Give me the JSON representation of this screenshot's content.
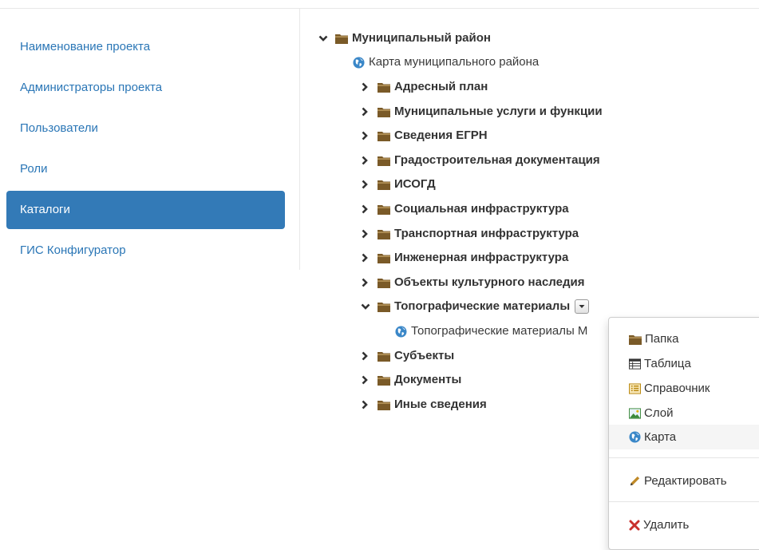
{
  "colors": {
    "link": "#2a76b6",
    "active_bg": "#337ab7",
    "folder_icon": "#7a5a28",
    "globe_icon": "#3a87c8",
    "delete_icon": "#c9302c"
  },
  "sidebar": {
    "items": [
      {
        "label": "Наименование проекта",
        "active": false
      },
      {
        "label": "Администраторы проекта",
        "active": false
      },
      {
        "label": "Пользователи",
        "active": false
      },
      {
        "label": "Роли",
        "active": false
      },
      {
        "label": "Каталоги",
        "active": true
      },
      {
        "label": "ГИС Конфигуратор",
        "active": false
      }
    ]
  },
  "tree": {
    "root": {
      "label": "Муниципальный район",
      "icon": "folder-icon",
      "expanded": true
    },
    "root_map": {
      "label": "Карта муниципального района",
      "icon": "globe-icon"
    },
    "folders": [
      {
        "label": "Адресный план",
        "expanded": false
      },
      {
        "label": "Муниципальные услуги и функции",
        "expanded": false
      },
      {
        "label": "Сведения ЕГРН",
        "expanded": false
      },
      {
        "label": "Градостроительная документация",
        "expanded": false
      },
      {
        "label": "ИСОГД",
        "expanded": false
      },
      {
        "label": "Социальная инфраструктура",
        "expanded": false
      },
      {
        "label": "Транспортная инфраструктура",
        "expanded": false
      },
      {
        "label": "Инженерная инфраструктура",
        "expanded": false
      },
      {
        "label": "Объекты культурного наследия",
        "expanded": false
      },
      {
        "label": "Топографические материалы",
        "expanded": true
      },
      {
        "label": "Субъекты",
        "expanded": false
      },
      {
        "label": "Документы",
        "expanded": false
      },
      {
        "label": "Иные сведения",
        "expanded": false
      }
    ],
    "child_map": {
      "label": "Топографические материалы М",
      "icon": "globe-icon"
    }
  },
  "context_menu": {
    "items": [
      {
        "label": "Папка",
        "icon": "folder-icon"
      },
      {
        "label": "Таблица",
        "icon": "table-icon"
      },
      {
        "label": "Справочник",
        "icon": "list-icon"
      },
      {
        "label": "Слой",
        "icon": "picture-icon"
      },
      {
        "label": "Карта",
        "icon": "globe-icon"
      },
      {
        "label": "Редактировать",
        "icon": "pencil-icon"
      },
      {
        "label": "Удалить",
        "icon": "delete-icon"
      }
    ]
  }
}
